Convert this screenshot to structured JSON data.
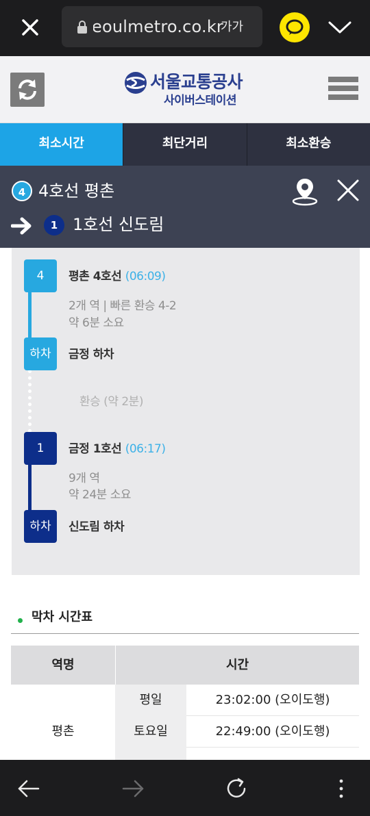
{
  "browser": {
    "url": "seoulmetro.co.kr",
    "font_size_label": "가가"
  },
  "site": {
    "logo_main": "서울교통공사",
    "logo_sub": "사이버스테이션"
  },
  "tabs": [
    {
      "label": "최소시간",
      "active": true
    },
    {
      "label": "최단거리",
      "active": false
    },
    {
      "label": "최소환승",
      "active": false
    }
  ],
  "route": {
    "origin_line_number": "4",
    "origin": "4호선 평촌",
    "dest_line_number": "1",
    "destination": "1호선 신도림"
  },
  "steps": {
    "board1_box": "4",
    "board1_station": "평촌 4호선",
    "board1_time": "(06:09)",
    "board1_info1": "2개 역 | 빠른 환승 4-2",
    "board1_info2": "약 6분 소요",
    "alight1_box": "하차",
    "alight1_label": "금정 하차",
    "transfer": "환승 (약 2분)",
    "board2_box": "1",
    "board2_station": "금정 1호선",
    "board2_time": "(06:17)",
    "board2_info1": "9개 역",
    "board2_info2": "약 24분 소요",
    "alight2_box": "하차",
    "alight2_label": "신도림 하차"
  },
  "last_train": {
    "title": "막차 시간표",
    "col_station": "역명",
    "col_time": "시간",
    "station": "평촌",
    "rows": [
      {
        "day": "평일",
        "time": "23:02:00 (오이도행)"
      },
      {
        "day": "토요일",
        "time": "22:49:00 (오이도행)"
      }
    ]
  },
  "colors": {
    "line4": "#27a8e0",
    "line1": "#0d2e8a",
    "active_tab": "#1da4e6",
    "route_header": "#3d4253"
  }
}
